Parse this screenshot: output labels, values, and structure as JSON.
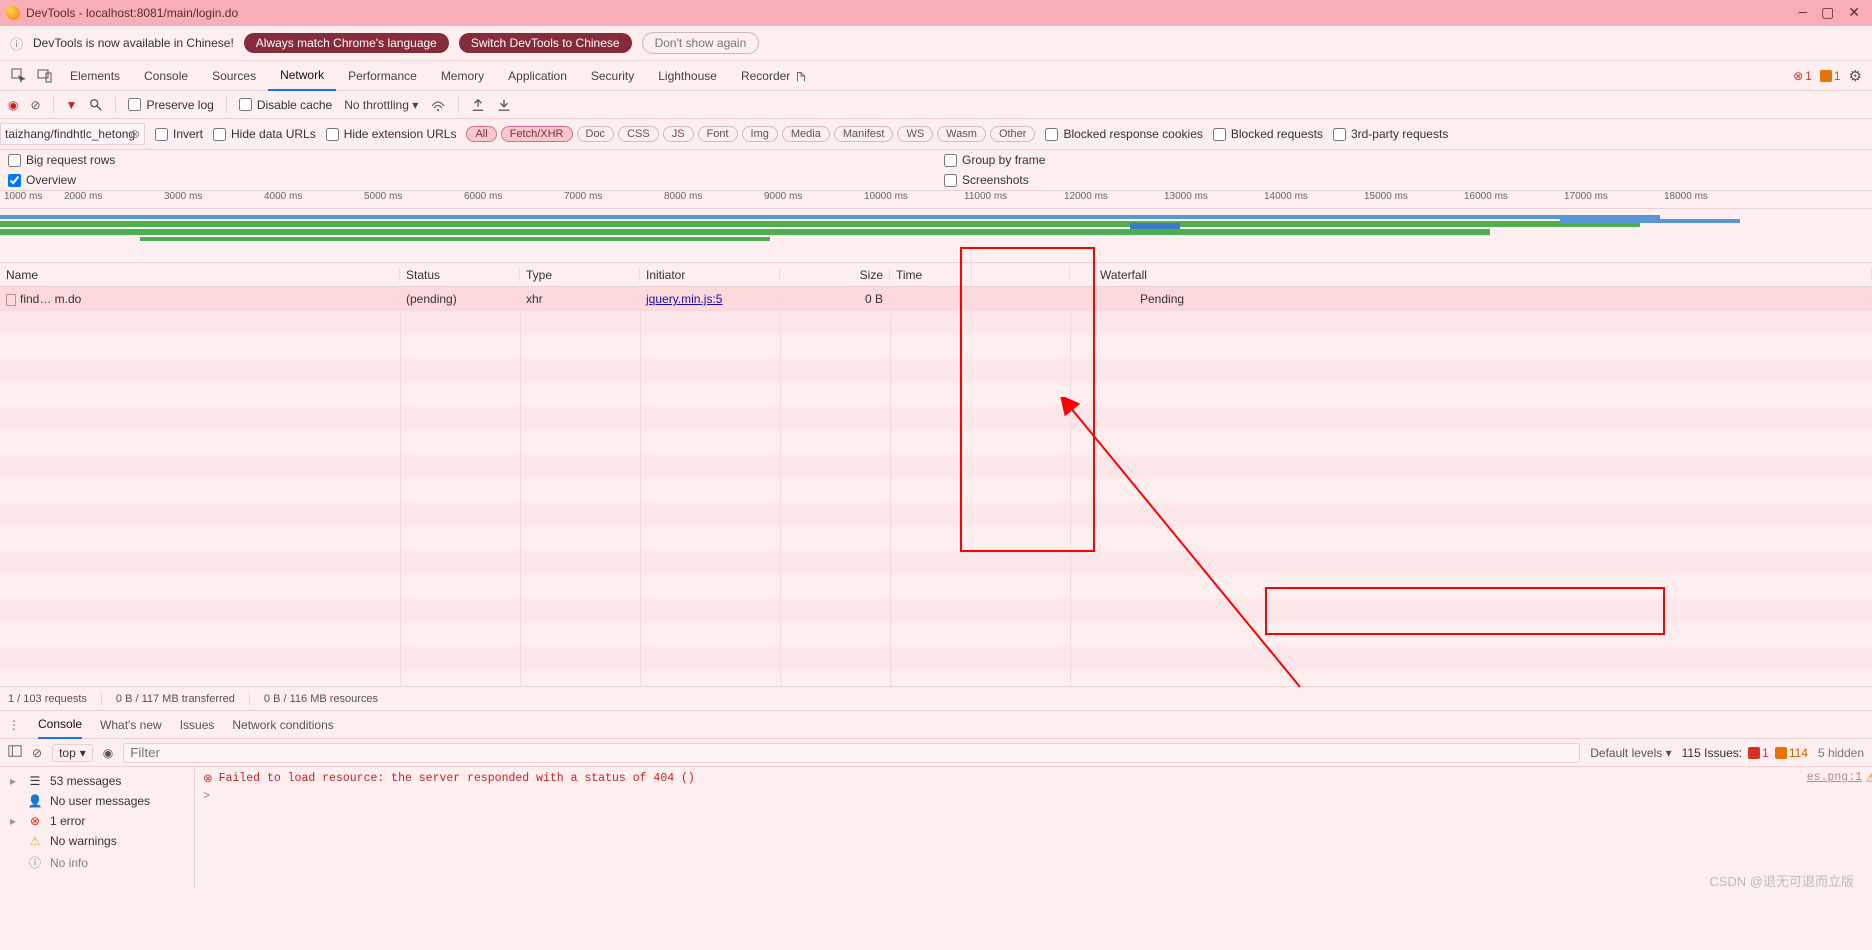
{
  "window": {
    "title": "DevTools - localhost:8081/main/login.do"
  },
  "promo": {
    "text": "DevTools is now available in Chinese!",
    "btn_match": "Always match Chrome's language",
    "btn_switch": "Switch DevTools to Chinese",
    "btn_dont": "Don't show again"
  },
  "maintabs": {
    "items": [
      "Elements",
      "Console",
      "Sources",
      "Network",
      "Performance",
      "Memory",
      "Application",
      "Security",
      "Lighthouse"
    ],
    "recorder": "Recorder",
    "active": "Network",
    "err_count": "1",
    "warn_count": "1"
  },
  "net_toolbar": {
    "preserve": "Preserve log",
    "disable_cache": "Disable cache",
    "throttle": "No throttling"
  },
  "filters": {
    "input_value": "taizhang/findhtlc_hetong",
    "invert": "Invert",
    "hide_data": "Hide data URLs",
    "hide_ext": "Hide extension URLs",
    "types": [
      "All",
      "Fetch/XHR",
      "Doc",
      "CSS",
      "JS",
      "Font",
      "Img",
      "Media",
      "Manifest",
      "WS",
      "Wasm",
      "Other"
    ],
    "active_types": [
      "All",
      "Fetch/XHR"
    ],
    "blocked_cookies": "Blocked response cookies",
    "blocked_req": "Blocked requests",
    "third_party": "3rd-party requests"
  },
  "opts": {
    "big_rows": "Big request rows",
    "overview": "Overview",
    "group_frame": "Group by frame",
    "screenshots": "Screenshots"
  },
  "timeline": {
    "ticks": [
      "1000 ms",
      "2000 ms",
      "3000 ms",
      "4000 ms",
      "5000 ms",
      "6000 ms",
      "7000 ms",
      "8000 ms",
      "9000 ms",
      "10000 ms",
      "11000 ms",
      "12000 ms",
      "13000 ms",
      "14000 ms",
      "15000 ms",
      "16000 ms",
      "17000 ms",
      "18000 ms"
    ]
  },
  "columns": {
    "name": "Name",
    "status": "Status",
    "type": "Type",
    "initiator": "Initiator",
    "size": "Size",
    "time": "Time",
    "waterfall": "Waterfall"
  },
  "row": {
    "name": "find…                       m.do",
    "status": "(pending)",
    "type": "xhr",
    "initiator": "jquery.min.js:5",
    "size": "0 B",
    "time": "",
    "waterfall": "Pending"
  },
  "status": {
    "requests": "1 / 103 requests",
    "transferred": "0 B / 117 MB transferred",
    "resources": "0 B / 116 MB resources"
  },
  "drawer": {
    "tabs": [
      "Console",
      "What's new",
      "Issues",
      "Network conditions"
    ],
    "active": "Console"
  },
  "console_toolbar": {
    "context": "top",
    "filter_placeholder": "Filter",
    "levels": "Default levels",
    "issues_label": "115 Issues:",
    "issues_err": "1",
    "issues_warn": "114",
    "hidden": "5 hidden"
  },
  "sidebar": {
    "messages": "53 messages",
    "no_user": "No user messages",
    "errors": "1 error",
    "no_warn": "No warnings",
    "no_info": "No info"
  },
  "console": {
    "error_text": "Failed to load resource: the server responded with a status of 404 ()",
    "error_src": "es.png:1",
    "prompt": ">"
  },
  "watermark": "CSDN @退无可退而立版"
}
